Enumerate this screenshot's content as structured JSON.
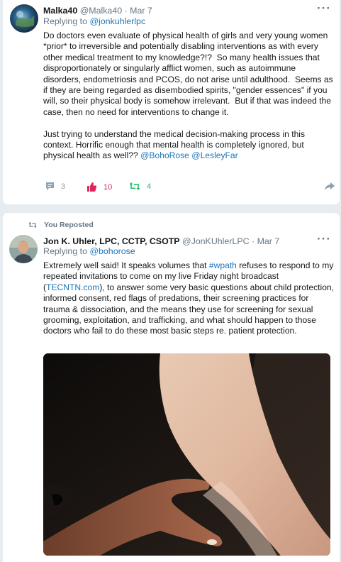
{
  "tweet1": {
    "display_name": "Malka40",
    "handle": "@Malka40",
    "date": "Mar 7",
    "more": "···",
    "replying_prefix": "Replying to ",
    "replying_to": "@jonkuhlerlpc",
    "body_main": "Do doctors even evaluate of physical health of girls and very young women *prior* to irreversible and potentially disabling interventions as with every other medical treatment to my knowledge?!?  So many health issues that disproportionately or singularly afflict women, such as autoimmune disorders, endometriosis and PCOS, do not arise until adulthood.  Seems as if they are being regarded as disembodied spirits, \"gender essences\" if you will, so their physical body is somehow irrelevant.  But if that was indeed the case, then no need for interventions to change it.\n\nJust trying to understand the medical decision-making process in this context. Horrific enough that mental health is completely ignored, but physical health as well?? ",
    "mention1": "@BohoRose",
    "mention2": "@LesleyFar",
    "stats": {
      "comments": "3",
      "likes": "10",
      "retweets": "4"
    },
    "colors": {
      "comment": "#8aa1b4",
      "like": "#e0245e",
      "retweet": "#17bf63",
      "share": "#8aa1b4"
    }
  },
  "tweet2": {
    "repost_label": "You Reposted",
    "display_name": "Jon K. Uhler, LPC, CCTP, CSOTP",
    "handle": "@JonKUhlerLPC",
    "date": "Mar 7",
    "more": "···",
    "replying_prefix": "Replying to ",
    "replying_to": "@bohorose",
    "body_a": "Extremely well said! It speaks volumes that ",
    "hashtag": "#wpath",
    "body_b": " refuses to respond to my repeated invitations to come on my live Friday night broadcast (",
    "link": "TECNTN.com",
    "body_c": "), to answer some very basic questions about child protection, informed consent, red flags of predations, their screening practices for trauma & dissociation, and the means they use for screening for sexual grooming, exploitation, and trafficking, and what should happen to those doctors who fail to do these most basic steps re. patient protection."
  },
  "icons": [
    "comment-icon",
    "thumbs-up-icon",
    "retweet-icon",
    "share-icon",
    "repost-icon",
    "more-icon"
  ]
}
